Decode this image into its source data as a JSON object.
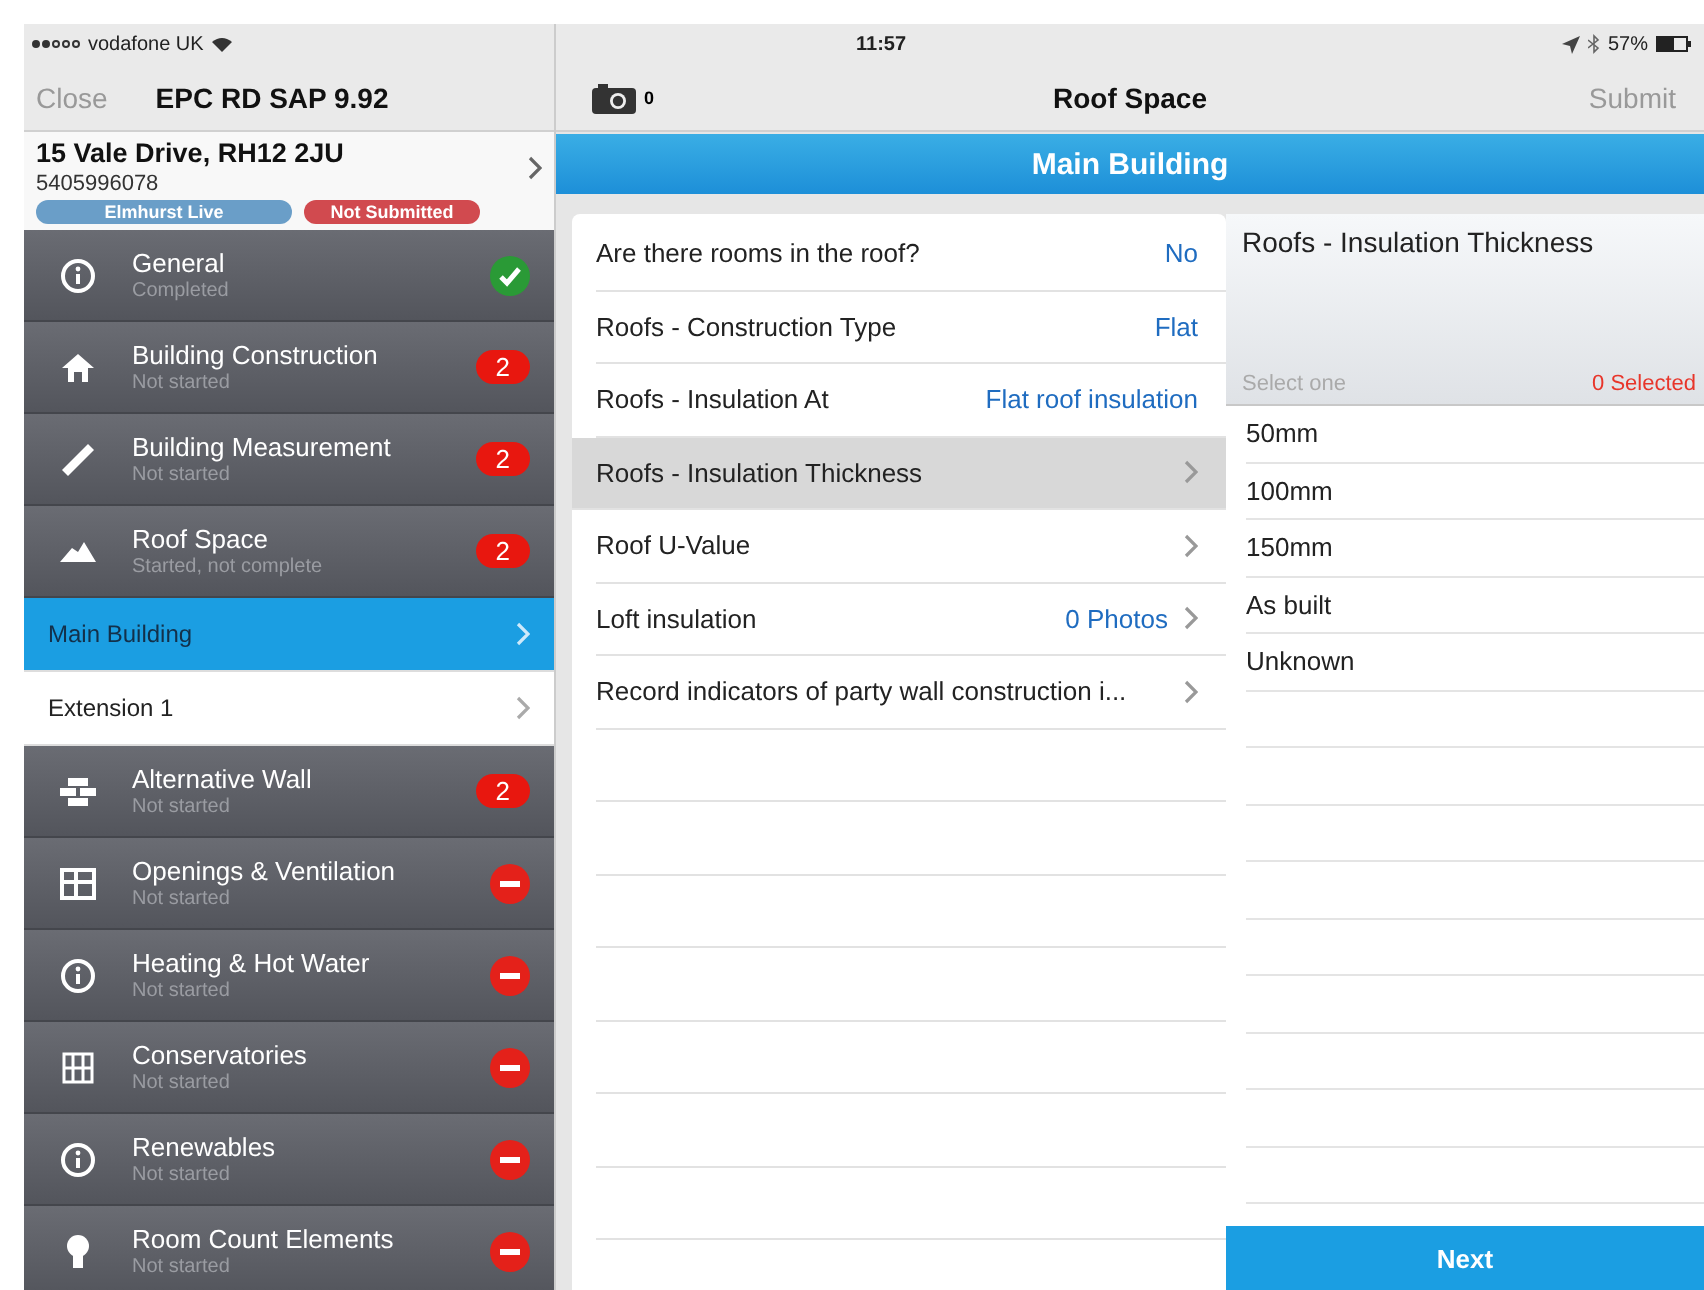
{
  "status_bar": {
    "carrier": "vodafone UK",
    "time": "11:57",
    "battery": "57%"
  },
  "sidebar": {
    "close": "Close",
    "title": "EPC RD SAP 9.92",
    "address": {
      "line": "15 Vale Drive, RH12 2JU",
      "reference": "5405996078",
      "tags": [
        {
          "label": "Elmhurst Live",
          "color": "#6a9ec8"
        },
        {
          "label": "Not Submitted",
          "color": "#d14a4f"
        }
      ]
    },
    "items": [
      {
        "kind": "section",
        "title": "General",
        "subtitle": "Completed",
        "badge": {
          "kind": "check"
        }
      },
      {
        "kind": "section",
        "title": "Building Construction",
        "subtitle": "Not started",
        "badge": {
          "kind": "count",
          "text": "2"
        }
      },
      {
        "kind": "section",
        "title": "Building Measurement",
        "subtitle": "Not started",
        "badge": {
          "kind": "count",
          "text": "2"
        }
      },
      {
        "kind": "section",
        "title": "Roof Space",
        "subtitle": "Started, not complete",
        "badge": {
          "kind": "count",
          "text": "2"
        }
      },
      {
        "kind": "sub",
        "title": "Main Building",
        "selected": true
      },
      {
        "kind": "sub",
        "title": "Extension 1",
        "selected": false
      },
      {
        "kind": "section",
        "title": "Alternative Wall",
        "subtitle": "Not started",
        "badge": {
          "kind": "count",
          "text": "2"
        }
      },
      {
        "kind": "section",
        "title": "Openings & Ventilation",
        "subtitle": "Not started",
        "badge": {
          "kind": "minus"
        }
      },
      {
        "kind": "section",
        "title": "Heating & Hot Water",
        "subtitle": "Not started",
        "badge": {
          "kind": "minus"
        }
      },
      {
        "kind": "section",
        "title": "Conservatories",
        "subtitle": "Not started",
        "badge": {
          "kind": "minus"
        }
      },
      {
        "kind": "section",
        "title": "Renewables",
        "subtitle": "Not started",
        "badge": {
          "kind": "minus"
        }
      },
      {
        "kind": "section",
        "title": "Room Count Elements",
        "subtitle": "Not started",
        "badge": {
          "kind": "minus"
        }
      }
    ]
  },
  "header": {
    "photo_count": "0",
    "title": "Roof Space",
    "submit": "Submit",
    "section": "Main Building"
  },
  "form": {
    "rows": [
      {
        "label": "Are there rooms in the roof?",
        "value": "No",
        "chevron": false,
        "selected": false
      },
      {
        "label": "Roofs - Construction Type",
        "value": "Flat",
        "chevron": false,
        "selected": false
      },
      {
        "label": "Roofs - Insulation At",
        "value": "Flat roof insulation",
        "chevron": false,
        "selected": false
      },
      {
        "label": "Roofs - Insulation Thickness",
        "chevron": true,
        "selected": true
      },
      {
        "label": "Roof U-Value",
        "chevron": true,
        "selected": false
      },
      {
        "label": "Loft insulation",
        "value": "0 Photos",
        "chevron": true,
        "selected": false
      },
      {
        "label": "Record indicators of party wall construction i...",
        "chevron": true,
        "selected": false
      }
    ]
  },
  "picker": {
    "title": "Roofs - Insulation Thickness",
    "hint": "Select one",
    "selected_count": "0 Selected",
    "options": [
      {
        "label": "50mm",
        "selected": false
      },
      {
        "label": "100mm",
        "selected": false
      },
      {
        "label": "150mm",
        "selected": false
      },
      {
        "label": "As built",
        "selected": false
      },
      {
        "label": "Unknown",
        "selected": false
      }
    ],
    "next": "Next"
  }
}
